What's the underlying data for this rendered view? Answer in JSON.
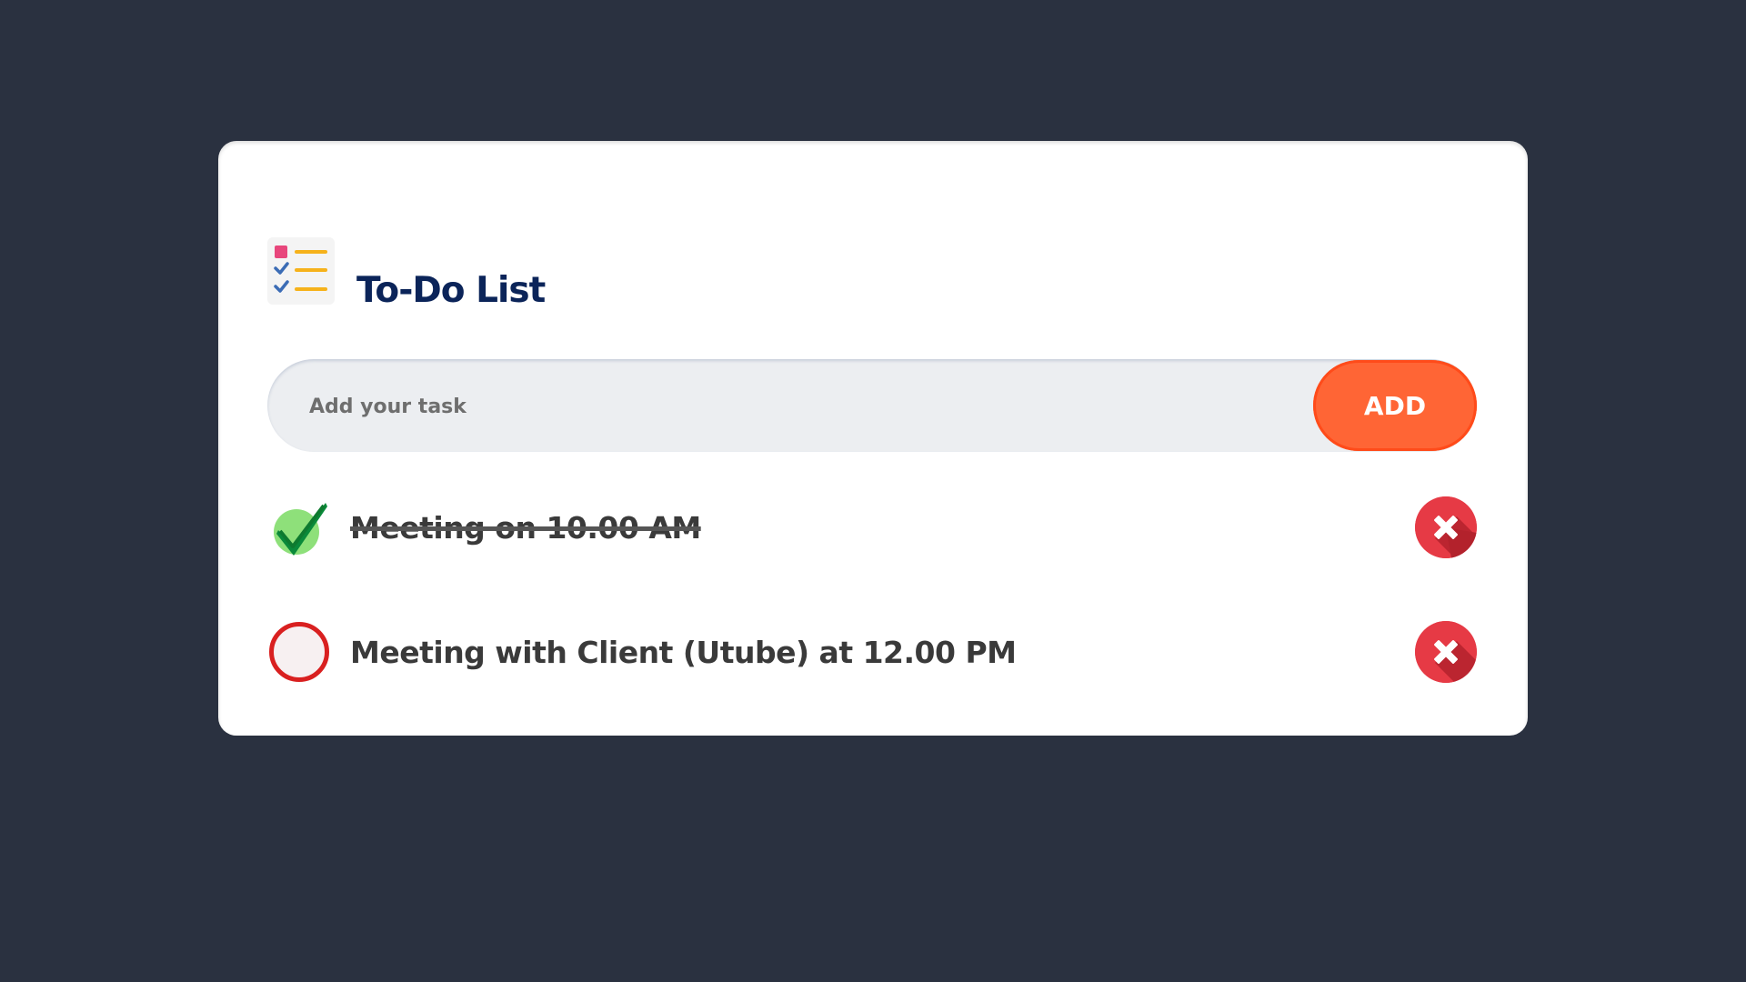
{
  "app": {
    "title": "To-Do List",
    "icon": "checklist-icon"
  },
  "input": {
    "placeholder": "Add your task",
    "value": "",
    "add_label": "ADD"
  },
  "tasks": [
    {
      "text": "Meeting on 10.00 AM",
      "completed": true,
      "status_icon": "checkmark-icon",
      "delete_icon": "close-icon"
    },
    {
      "text": "Meeting with Client (Utube) at 12.00 PM",
      "completed": false,
      "status_icon": "empty-circle-icon",
      "delete_icon": "close-icon"
    }
  ],
  "colors": {
    "background": "#2a3140",
    "card": "#ffffff",
    "title": "#0b2459",
    "accent": "#ff6535",
    "delete": "#e63a45",
    "check": "#0a8a3a",
    "unchecked_ring": "#d92020"
  }
}
